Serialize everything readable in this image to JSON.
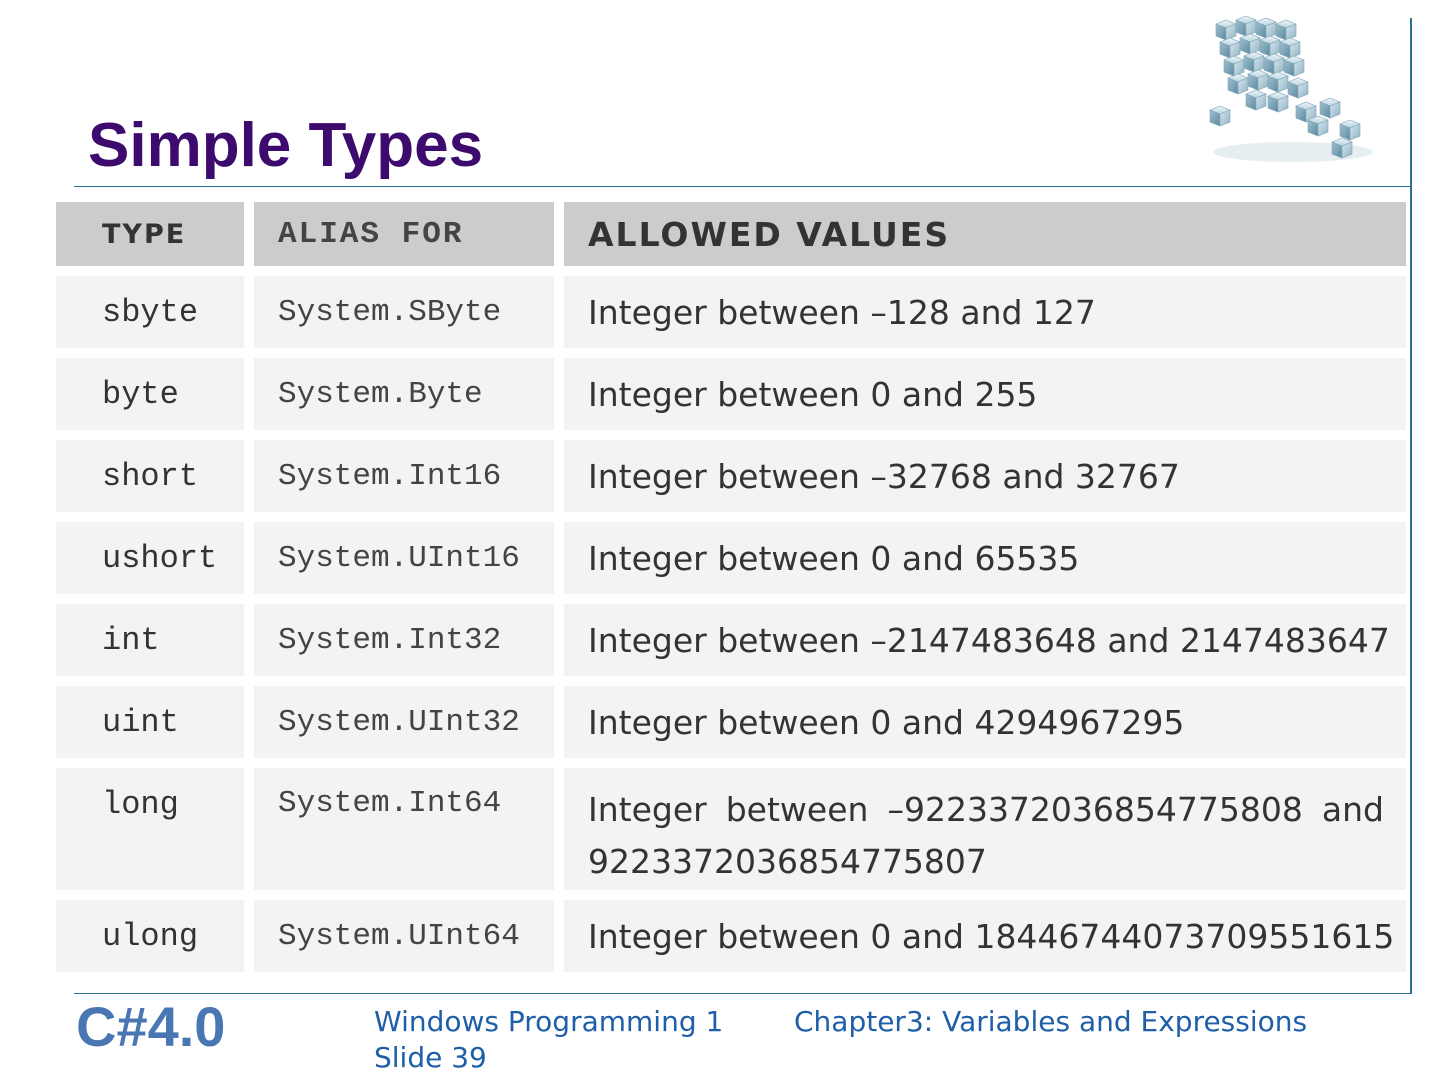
{
  "slide": {
    "title": "Simple Types"
  },
  "table": {
    "headers": [
      "TYPE",
      "ALIAS FOR",
      "ALLOWED VALUES"
    ],
    "rows": [
      {
        "type": "sbyte",
        "alias": "System.SByte",
        "values": "Integer between –128 and 127"
      },
      {
        "type": "byte",
        "alias": "System.Byte",
        "values": "Integer between 0 and 255"
      },
      {
        "type": "short",
        "alias": "System.Int16",
        "values": "Integer between –32768 and 32767"
      },
      {
        "type": "ushort",
        "alias": "System.UInt16",
        "values": "Integer between 0 and 65535"
      },
      {
        "type": "int",
        "alias": "System.Int32",
        "values": "Integer between –2147483648 and 2147483647"
      },
      {
        "type": "uint",
        "alias": "System.UInt32",
        "values": "Integer between 0 and 4294967295"
      },
      {
        "type": "long",
        "alias": "System.Int64",
        "values": "Integer between –9223372036854775808 and 9223372036854775807"
      },
      {
        "type": "ulong",
        "alias": "System.UInt64",
        "values": "Integer between 0 and 18446744073709551615"
      }
    ]
  },
  "footer": {
    "brand": "C#4.0",
    "course": "Windows Programming 1",
    "slide": "Slide 39",
    "chapter": "Chapter3: Variables and Expressions"
  },
  "colors": {
    "title": "#3d0a6e",
    "rule": "#2a6f97",
    "header_fill": "#cccccc",
    "cell_fill": "#f3f3f3",
    "footer_text": "#1f5fa8",
    "brand": "#4a77b4"
  },
  "icons": {
    "logo": "cube-cluster-logo"
  }
}
